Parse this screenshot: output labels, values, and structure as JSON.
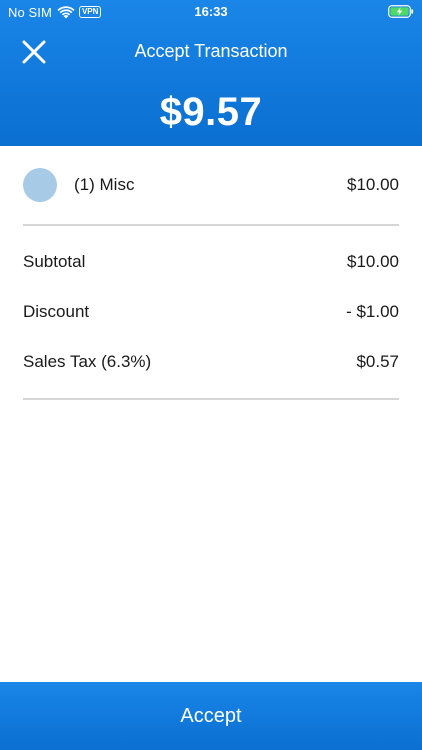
{
  "status_bar": {
    "carrier": "No SIM",
    "vpn": "VPN",
    "time": "16:33"
  },
  "header": {
    "title": "Accept Transaction",
    "total": "$9.57"
  },
  "items": [
    {
      "label": "(1) Misc",
      "price": "$10.00"
    }
  ],
  "summary": {
    "subtotal_label": "Subtotal",
    "subtotal_value": "$10.00",
    "discount_label": "Discount",
    "discount_value": "- $1.00",
    "tax_label": "Sales Tax (6.3%)",
    "tax_value": "$0.57"
  },
  "footer": {
    "accept_label": "Accept"
  },
  "colors": {
    "brand_blue": "#0a6fd1",
    "item_avatar": "#a7cae6",
    "divider": "#d6d6d6",
    "battery_green": "#4cd964"
  },
  "icons": {
    "close": "close-icon",
    "wifi": "wifi-icon",
    "battery": "battery-charging-icon"
  }
}
